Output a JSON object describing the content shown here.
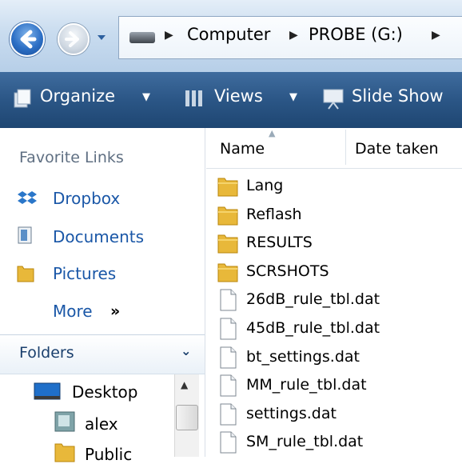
{
  "address": {
    "breadcrumbs": [
      "Computer",
      "PROBE (G:)"
    ]
  },
  "toolbar": {
    "organize": "Organize",
    "views": "Views",
    "slideshow": "Slide Show"
  },
  "favorites": {
    "title": "Favorite Links",
    "links": [
      "Dropbox",
      "Documents",
      "Pictures"
    ],
    "more": "More"
  },
  "folders": {
    "title": "Folders",
    "tree": [
      "Desktop",
      "alex",
      "Public"
    ]
  },
  "columns": {
    "name": "Name",
    "date_taken": "Date taken"
  },
  "files": [
    {
      "name": "Lang",
      "type": "folder"
    },
    {
      "name": "Reflash",
      "type": "folder"
    },
    {
      "name": "RESULTS",
      "type": "folder"
    },
    {
      "name": "SCRSHOTS",
      "type": "folder"
    },
    {
      "name": "26dB_rule_tbl.dat",
      "type": "file"
    },
    {
      "name": "45dB_rule_tbl.dat",
      "type": "file"
    },
    {
      "name": "bt_settings.dat",
      "type": "file"
    },
    {
      "name": "MM_rule_tbl.dat",
      "type": "file"
    },
    {
      "name": "settings.dat",
      "type": "file"
    },
    {
      "name": "SM_rule_tbl.dat",
      "type": "file"
    }
  ],
  "colors": {
    "toolbar": "#2b5686",
    "link": "#1a57a7",
    "folder": "#e8b83a"
  },
  "icons": {
    "back": "back-arrow-icon",
    "forward": "forward-arrow-icon",
    "drive": "drive-icon",
    "organize": "organize-icon",
    "views": "views-icon",
    "slideshow": "slideshow-icon",
    "dropbox": "dropbox-icon",
    "documents": "documents-icon",
    "pictures": "pictures-folder-icon",
    "desktop": "desktop-icon",
    "user": "user-folder-icon",
    "folder": "folder-icon",
    "file": "file-icon"
  }
}
